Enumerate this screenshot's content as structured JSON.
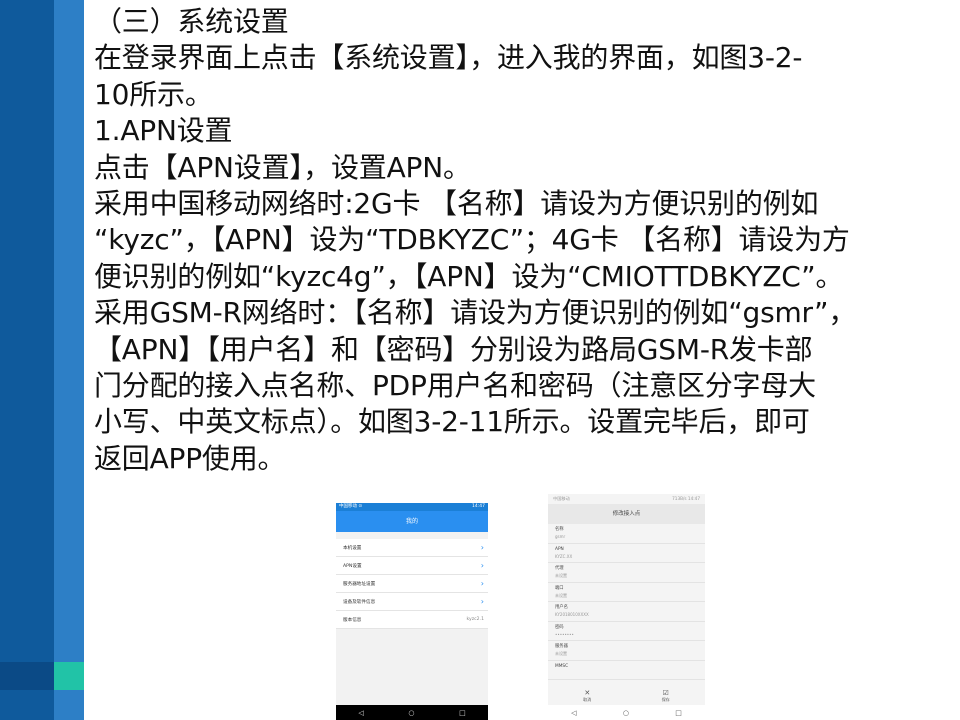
{
  "slide": {
    "lines": [
      "（三）系统设置",
      "在登录界面上点击【系统设置】，进入我的界面，如图3-2-",
      "10所示。",
      "1.APN设置",
      "点击【APN设置】，设置APN。",
      "采用中国移动网络时:2G卡 【名称】请设为方便识别的例如",
      "“kyzc”，【APN】设为“TDBKYZC”；4G卡 【名称】请设为方",
      "便识别的例如“kyzc4g”，【APN】设为“CMIOTTDBKYZC”。",
      "采用GSM-R网络时：【名称】请设为方便识别的例如“gsmr”，",
      "【APN】【用户名】和【密码】分别设为路局GSM-R发卡部",
      "门分配的接入点名称、PDP用户名和密码（注意区分字母大",
      "小写、中英文标点）。如图3-2-11所示。设置完毕后，即可",
      "返回APP使用。"
    ]
  },
  "phone_left": {
    "status_left": "中国移动 ⊙",
    "status_right": "14:47",
    "title": "我的",
    "items": [
      {
        "label": "本机设置"
      },
      {
        "label": "APN设置"
      },
      {
        "label": "服务器地址设置"
      },
      {
        "label": "设备及软件信息"
      }
    ],
    "version_label": "版本信息",
    "version_value": "kyzc2.1",
    "nav": [
      "◁",
      "○",
      "□"
    ]
  },
  "phone_right": {
    "status_left": "中国移动",
    "status_right": "713B/s 14:47",
    "title": "修改接入点",
    "fields": [
      {
        "label": "名称",
        "value": "gsmr"
      },
      {
        "label": "APN",
        "value": "KYZC.XX"
      },
      {
        "label": "代理",
        "value": "未设置"
      },
      {
        "label": "端口",
        "value": "未设置"
      },
      {
        "label": "用户名",
        "value": "KY2018010XXXX"
      },
      {
        "label": "密码",
        "value": "••••••••"
      },
      {
        "label": "服务器",
        "value": "未设置"
      },
      {
        "label": "MMSC",
        "value": ""
      }
    ],
    "bottom_actions": [
      {
        "icon": "✕",
        "label": "取消"
      },
      {
        "icon": "☑",
        "label": "保存"
      }
    ],
    "nav": [
      "◁",
      "○",
      "□"
    ]
  },
  "colors": {
    "stripe_dark": "#0f5a9c",
    "stripe_light": "#2d7fc6",
    "stripe_accent": "#21c3a7",
    "app_blue": "#2a8ff0"
  }
}
